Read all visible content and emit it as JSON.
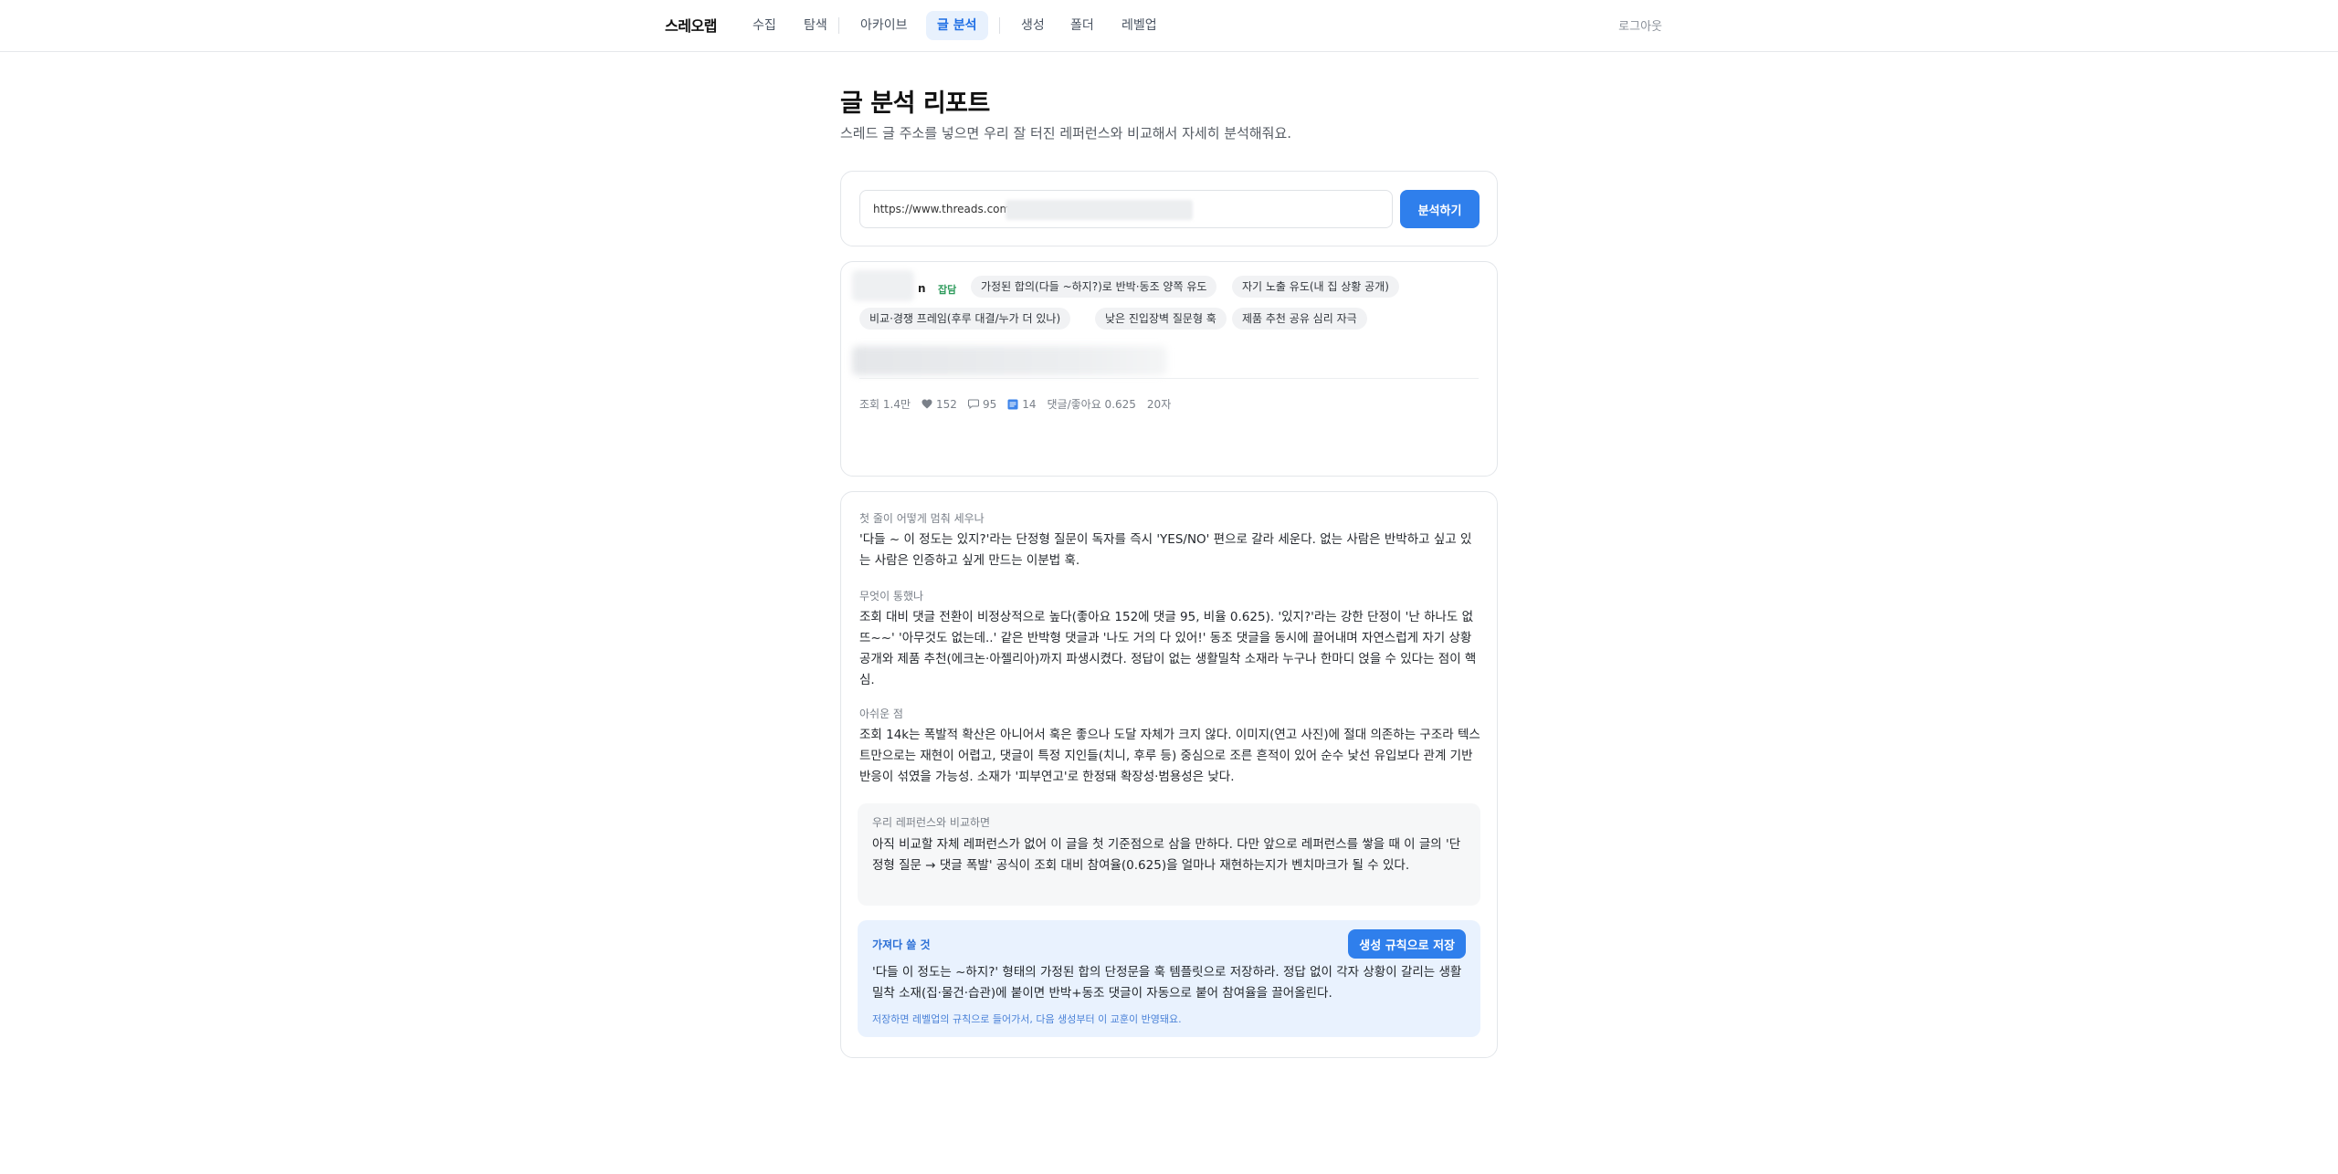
{
  "nav": {
    "brand": "스레오랩",
    "items": [
      {
        "label": "수집"
      },
      {
        "label": "탐색"
      },
      {
        "label": "아카이브"
      },
      {
        "label": "글 분석"
      },
      {
        "label": "생성"
      },
      {
        "label": "폴더"
      },
      {
        "label": "레벨업"
      }
    ],
    "active_item": "글 분석",
    "logout": "로그아웃"
  },
  "header": {
    "title": "글 분석 리포트",
    "subtitle": "스레드 글 주소를 넣으면 우리 잘 터진 레퍼런스와 비교해서 자세히 분석해줘요."
  },
  "url_form": {
    "value": "https://www.threads.com",
    "submit_label": "분석하기"
  },
  "post": {
    "author_tail": "n",
    "category_tag": "잡담",
    "tags": [
      "가정된 합의(다들 ~하지?)로 반박·동조 양쪽 유도",
      "자기 노출 유도(내 집 상황 공개)",
      "비교·경쟁 프레임(후루 대결/누가 더 있나)",
      "낮은 진입장벽 질문형 훅",
      "제품 추천 공유 심리 자극"
    ],
    "stats": {
      "views": "조회 1.4만",
      "likes": "152",
      "comments": "95",
      "reposts": "14",
      "ratio": "댓글/좋아요 0.625",
      "age": "20자"
    }
  },
  "analysis": {
    "hook_label": "첫 줄이 어떻게 멈춰 세우나",
    "hook_body": "'다들 ~ 이 정도는 있지?'라는 단정형 질문이 독자를 즉시 'YES/NO' 편으로 갈라 세운다. 없는 사람은 반박하고 싶고 있는 사람은 인증하고 싶게 만드는 이분법 훅.",
    "why_label": "무엇이 통했나",
    "why_body": "조회 대비 댓글 전환이 비정상적으로 높다(좋아요 152에 댓글 95, 비율 0.625). '있지?'라는 강한 단정이 '난 하나도 없뜨~~' '아무것도 없는데..' 같은 반박형 댓글과 '나도 거의 다 있어!' 동조 댓글을 동시에 끌어내며 자연스럽게 자기 상황 공개와 제품 추천(에크논·아젤리아)까지 파생시켰다. 정답이 없는 생활밀착 소재라 누구나 한마디 얹을 수 있다는 점이 핵심.",
    "weak_label": "아쉬운 점",
    "weak_body": "조회 14k는 폭발적 확산은 아니어서 훅은 좋으나 도달 자체가 크지 않다. 이미지(연고 사진)에 절대 의존하는 구조라 텍스트만으로는 재현이 어렵고, 댓글이 특정 지인들(치니, 후루 등) 중심으로 조른 흔적이 있어 순수 낯선 유입보다 관계 기반 반응이 섞였을 가능성. 소재가 '피부연고'로 한정돼 확장성·범용성은 낮다.",
    "compare_label": "우리 레퍼런스와 비교하면",
    "compare_body": "아직 비교할 자체 레퍼런스가 없어 이 글을 첫 기준점으로 삼을 만하다. 다만 앞으로 레퍼런스를 쌓을 때 이 글의 '단정형 질문 → 댓글 폭발' 공식이 조회 대비 참여율(0.625)을 얼마나 재현하는지가 벤치마크가 될 수 있다.",
    "take_label": "가져다 쓸 것",
    "save_rule_label": "생성 규칙으로 저장",
    "take_body": "'다들 이 정도는 ~하지?' 형태의 가정된 합의 단정문을 훅 템플릿으로 저장하라. 정답 없이 각자 상황이 갈리는 생활밀착 소재(집·물건·습관)에 붙이면 반박+동조 댓글이 자동으로 붙어 참여율을 끌어올린다.",
    "take_note": "저장하면 레벨업의 규칙으로 들어가서, 다음 생성부터 이 교훈이 반영돼요."
  },
  "colors": {
    "accent": "#2f7fec",
    "nav_active_bg": "#e8f1fd",
    "take_box_bg": "#e9f2fe",
    "category_tag": "#2e9b5c"
  }
}
